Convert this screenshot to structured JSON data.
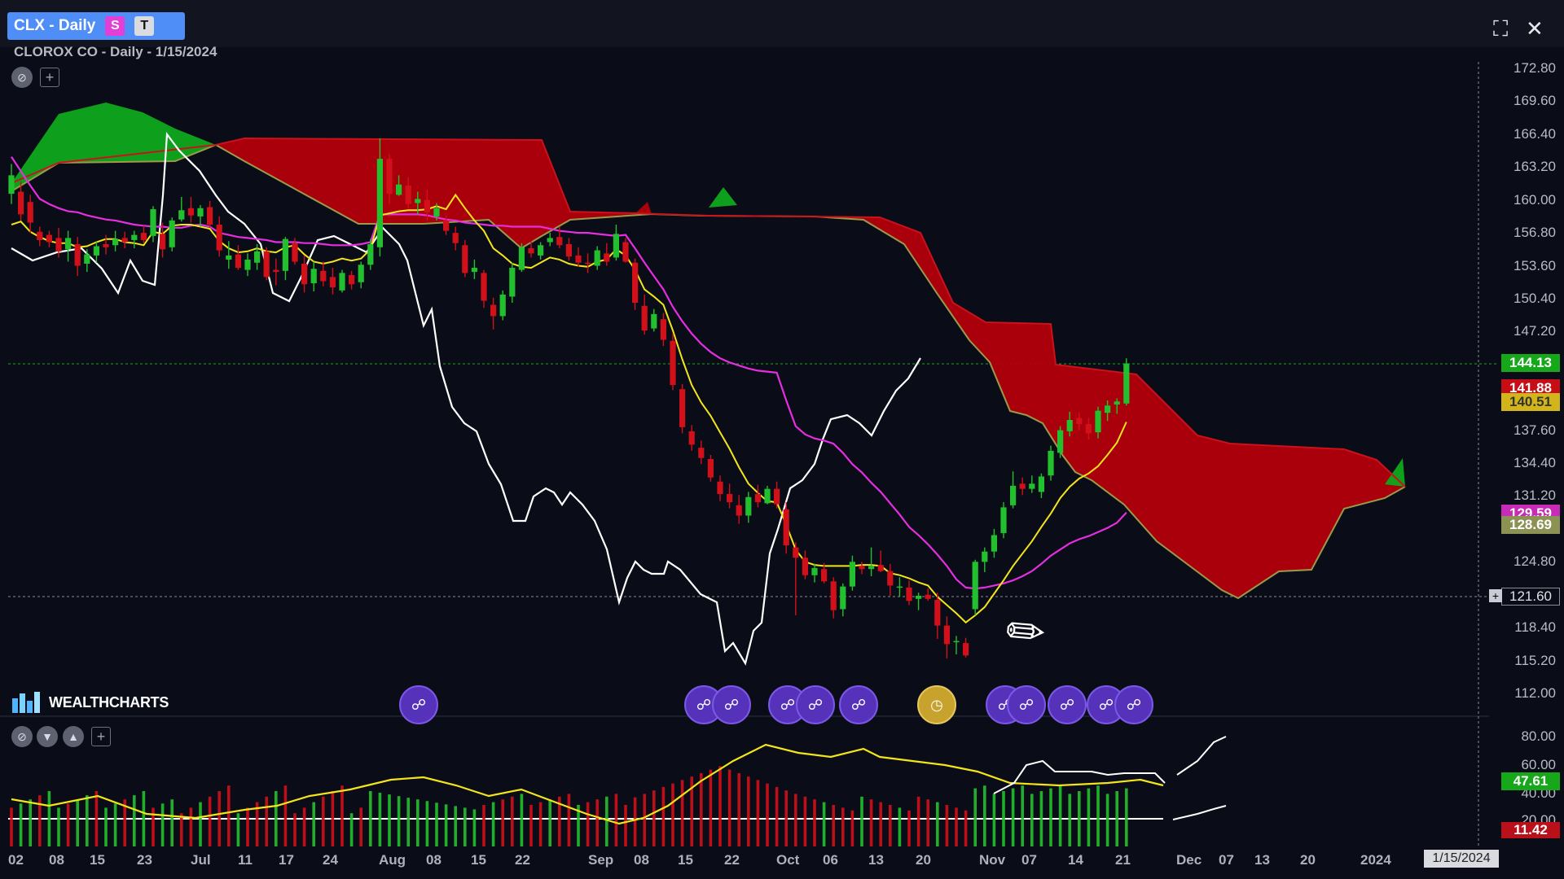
{
  "header": {
    "tab_title": "CLX - Daily",
    "badge_s": "S",
    "badge_t": "T",
    "subtitle": "CLOROX CO - Daily - 1/15/2024"
  },
  "toolbar_icons": [
    "no-entry-icon",
    "add-icon",
    "fullscreen-icon",
    "close-icon"
  ],
  "price_axis": [
    "172.80",
    "169.60",
    "166.40",
    "163.20",
    "160.00",
    "156.80",
    "153.60",
    "150.40",
    "147.20",
    "137.60",
    "134.40",
    "131.20",
    "128.00",
    "124.80",
    "118.40",
    "115.20",
    "112.00"
  ],
  "price_flags": {
    "last": "144.13",
    "red": "141.88",
    "yellow": "140.51",
    "magenta": "129.59",
    "olive": "128.69",
    "crosshair": "121.60"
  },
  "indicator_axis": [
    "80.00",
    "60.00",
    "40.00",
    "20.00"
  ],
  "indicator_flags": {
    "green": "47.61",
    "red": "11.42"
  },
  "date_axis": [
    "02",
    "08",
    "15",
    "23",
    "Jul",
    "11",
    "17",
    "24",
    "Aug",
    "08",
    "15",
    "22",
    "Sep",
    "08",
    "15",
    "22",
    "Oct",
    "06",
    "13",
    "20",
    "Nov",
    "07",
    "14",
    "21",
    "Dec",
    "07",
    "13",
    "20",
    "2024"
  ],
  "date_flag": "1/15/2024",
  "logo": {
    "text": "WEALTHCHARTS"
  },
  "colors": {
    "background": "#0a0d17",
    "bullish": "#22c02e",
    "bearish": "#d2101a",
    "cloud_bull": "#0fa81c",
    "cloud_bear": "#b3000c",
    "tenkan": "#f3e51c",
    "kijun": "#e52ee0",
    "chikou": "#ffffff",
    "span_line": "#9a9a4a",
    "accent": "#4f8ef7"
  },
  "chart_data": {
    "type": "candlestick",
    "ylim": [
      112.0,
      172.8
    ],
    "series": [
      {
        "values": [
          [
            160.6,
            163.5,
            159.6,
            162.4
          ],
          [
            160.8,
            161.8,
            158.0,
            158.6
          ],
          [
            159.8,
            160.5,
            156.8,
            157.8
          ],
          [
            156.9,
            157.4,
            155.5,
            156.1
          ],
          [
            156.6,
            157.0,
            155.4,
            155.9
          ],
          [
            156.3,
            157.3,
            154.4,
            155.0
          ],
          [
            155.2,
            157.0,
            154.0,
            156.3
          ],
          [
            155.7,
            156.4,
            152.6,
            153.6
          ],
          [
            153.8,
            155.2,
            153.0,
            154.7
          ],
          [
            154.6,
            156.0,
            153.9,
            155.5
          ],
          [
            155.7,
            156.6,
            154.7,
            155.4
          ],
          [
            155.6,
            157.0,
            155.0,
            156.2
          ],
          [
            156.3,
            156.9,
            155.3,
            155.9
          ],
          [
            156.1,
            157.0,
            155.3,
            156.6
          ],
          [
            156.8,
            157.5,
            155.8,
            156.1
          ],
          [
            156.5,
            159.4,
            155.9,
            159.1
          ],
          [
            156.7,
            157.8,
            154.4,
            155.2
          ],
          [
            155.4,
            158.3,
            155.0,
            158.0
          ],
          [
            158.1,
            160.3,
            157.9,
            159.0
          ],
          [
            159.2,
            160.3,
            157.8,
            158.5
          ],
          [
            158.4,
            159.5,
            157.4,
            159.2
          ],
          [
            159.3,
            159.9,
            157.3,
            157.6
          ],
          [
            157.6,
            158.4,
            154.5,
            155.1
          ],
          [
            154.2,
            156.0,
            153.3,
            154.6
          ],
          [
            154.7,
            155.6,
            153.2,
            153.4
          ],
          [
            153.2,
            154.8,
            152.6,
            154.2
          ],
          [
            153.9,
            155.7,
            153.2,
            155.0
          ],
          [
            155.0,
            155.4,
            152.2,
            152.5
          ],
          [
            153.2,
            154.3,
            151.7,
            153.0
          ],
          [
            153.1,
            156.4,
            152.2,
            156.2
          ],
          [
            155.8,
            156.3,
            153.7,
            154.0
          ],
          [
            153.8,
            154.6,
            151.0,
            151.8
          ],
          [
            151.9,
            154.0,
            151.1,
            153.3
          ],
          [
            153.1,
            154.0,
            151.6,
            152.1
          ],
          [
            152.5,
            153.4,
            150.8,
            151.5
          ],
          [
            151.2,
            153.2,
            151.0,
            152.9
          ],
          [
            152.7,
            153.1,
            151.3,
            151.8
          ],
          [
            152.0,
            154.0,
            151.4,
            153.7
          ],
          [
            153.7,
            156.2,
            153.2,
            155.7
          ],
          [
            155.4,
            166.0,
            154.5,
            164.0
          ],
          [
            164.0,
            164.5,
            159.6,
            160.6
          ],
          [
            160.5,
            162.4,
            160.4,
            161.5
          ],
          [
            161.4,
            162.2,
            159.2,
            159.6
          ],
          [
            159.7,
            160.8,
            158.6,
            160.1
          ],
          [
            160.0,
            161.0,
            158.0,
            158.8
          ],
          [
            158.4,
            159.7,
            158.0,
            159.2
          ],
          [
            158.0,
            158.5,
            156.6,
            157.0
          ],
          [
            156.8,
            157.4,
            155.1,
            155.8
          ],
          [
            155.6,
            156.1,
            152.5,
            152.9
          ],
          [
            153.0,
            154.2,
            152.3,
            153.4
          ],
          [
            152.9,
            153.2,
            149.5,
            150.2
          ],
          [
            149.8,
            150.5,
            147.4,
            148.7
          ],
          [
            148.7,
            151.2,
            148.3,
            150.8
          ],
          [
            150.6,
            153.9,
            150.0,
            153.4
          ],
          [
            153.2,
            155.8,
            153.0,
            155.4
          ],
          [
            155.3,
            156.0,
            154.4,
            154.8
          ],
          [
            154.6,
            155.9,
            154.2,
            155.6
          ],
          [
            155.9,
            156.8,
            155.5,
            156.3
          ],
          [
            156.4,
            157.4,
            155.3,
            155.6
          ],
          [
            155.7,
            156.3,
            154.1,
            154.5
          ],
          [
            154.6,
            155.4,
            153.5,
            153.9
          ],
          [
            153.9,
            154.8,
            152.9,
            153.8
          ],
          [
            153.6,
            155.5,
            153.2,
            155.1
          ],
          [
            154.8,
            155.8,
            153.6,
            154.0
          ],
          [
            154.4,
            157.6,
            154.1,
            156.7
          ],
          [
            155.9,
            156.3,
            153.9,
            154.0
          ],
          [
            153.9,
            154.3,
            149.3,
            150.0
          ],
          [
            149.7,
            150.8,
            146.9,
            147.3
          ],
          [
            147.5,
            149.4,
            147.2,
            148.9
          ],
          [
            148.4,
            149.0,
            145.8,
            146.4
          ],
          [
            146.3,
            147.0,
            141.5,
            142.0
          ],
          [
            141.6,
            142.1,
            137.3,
            137.9
          ],
          [
            137.5,
            138.1,
            135.6,
            136.2
          ],
          [
            135.9,
            136.6,
            134.3,
            134.9
          ],
          [
            134.8,
            135.2,
            132.6,
            133.0
          ],
          [
            132.6,
            133.2,
            130.7,
            131.4
          ],
          [
            131.4,
            132.4,
            130.0,
            130.6
          ],
          [
            130.3,
            131.3,
            128.5,
            129.3
          ],
          [
            129.3,
            131.6,
            128.6,
            131.1
          ],
          [
            131.4,
            132.3,
            130.1,
            130.6
          ],
          [
            130.5,
            132.2,
            130.4,
            131.9
          ],
          [
            131.9,
            132.6,
            130.0,
            130.4
          ],
          [
            129.9,
            130.6,
            125.6,
            126.4
          ],
          [
            126.2,
            126.7,
            119.6,
            125.2
          ],
          [
            125.2,
            125.9,
            123.1,
            123.5
          ],
          [
            123.5,
            124.6,
            122.8,
            124.2
          ],
          [
            124.1,
            124.7,
            122.7,
            122.9
          ],
          [
            122.9,
            123.3,
            119.3,
            120.1
          ],
          [
            120.2,
            122.7,
            119.5,
            122.4
          ],
          [
            122.4,
            125.4,
            122.0,
            124.8
          ],
          [
            124.4,
            124.8,
            123.6,
            124.1
          ],
          [
            124.1,
            126.2,
            123.4,
            124.4
          ],
          [
            124.5,
            125.9,
            123.8,
            123.9
          ],
          [
            123.9,
            124.6,
            121.5,
            122.5
          ],
          [
            122.4,
            123.3,
            121.4,
            122.4
          ],
          [
            122.3,
            123.0,
            120.6,
            121.0
          ],
          [
            121.2,
            121.8,
            120.1,
            121.5
          ],
          [
            121.6,
            122.2,
            121.0,
            121.2
          ],
          [
            121.1,
            121.8,
            117.3,
            118.6
          ],
          [
            118.6,
            119.5,
            115.4,
            116.8
          ],
          [
            117.0,
            117.6,
            115.8,
            117.1
          ],
          [
            116.9,
            117.4,
            115.5,
            115.7
          ],
          [
            120.2,
            125.0,
            119.6,
            124.8
          ],
          [
            124.8,
            126.2,
            123.8,
            125.8
          ],
          [
            125.8,
            128.0,
            125.2,
            127.4
          ],
          [
            127.6,
            130.6,
            127.1,
            130.1
          ],
          [
            130.3,
            133.6,
            130.0,
            132.2
          ],
          [
            132.4,
            133.0,
            131.3,
            131.9
          ],
          [
            131.9,
            133.2,
            131.5,
            132.4
          ],
          [
            131.6,
            133.4,
            131.0,
            133.1
          ],
          [
            133.2,
            136.1,
            132.7,
            135.6
          ],
          [
            135.4,
            138.0,
            134.9,
            137.6
          ],
          [
            137.5,
            139.4,
            137.0,
            138.6
          ],
          [
            138.8,
            139.3,
            137.6,
            138.2
          ],
          [
            138.2,
            138.8,
            136.7,
            137.3
          ],
          [
            137.4,
            139.9,
            136.8,
            139.5
          ],
          [
            139.3,
            140.5,
            138.5,
            140.0
          ],
          [
            140.1,
            140.7,
            139.2,
            140.4
          ],
          [
            140.2,
            144.6,
            140.0,
            144.1
          ]
        ]
      },
      {
        "name": "tenkan",
        "values": [
          157.6,
          157.9,
          156.9,
          156.4,
          156.0,
          155.8,
          155.8,
          155.4,
          155.5,
          155.9,
          156.2,
          156.2,
          155.9,
          155.8,
          155.6,
          156.9,
          156.7,
          157.5,
          157.6,
          157.6,
          157.4,
          157.2,
          156.0,
          155.3,
          154.9,
          155.0,
          155.3,
          155.0,
          154.9,
          155.4,
          155.6,
          154.7,
          154.0,
          153.8,
          154.0,
          154.3,
          154.1,
          154.3,
          155.2,
          158.5,
          158.7,
          158.9,
          159.0,
          159.0,
          159.1,
          159.4,
          159.1,
          160.5,
          159.2,
          158.0,
          157.0,
          155.3,
          154.6,
          153.8,
          153.5,
          153.4,
          153.9,
          154.4,
          154.2,
          153.8,
          153.6,
          153.5,
          154.0,
          154.2,
          155.2,
          154.6,
          153.2,
          151.3,
          150.6,
          149.8,
          147.3,
          144.5,
          142.0,
          140.3,
          139.0,
          137.4,
          135.8,
          134.0,
          132.4,
          131.5,
          130.7,
          130.6,
          128.4,
          126.0,
          124.8,
          124.5,
          124.4,
          124.4,
          124.4,
          124.4,
          124.5,
          124.5,
          124.4,
          123.7,
          123.5,
          123.2,
          122.8,
          122.5,
          121.4,
          120.6,
          119.8,
          118.9,
          119.6,
          120.4,
          121.7,
          123.0,
          124.4,
          125.6,
          126.8,
          128.2,
          129.5,
          131.0,
          132.1,
          132.9,
          133.4,
          134.1,
          135.2,
          136.4,
          138.4
        ]
      },
      {
        "name": "kijun",
        "values": [
          164.2,
          162.8,
          161.4,
          160.1,
          159.6,
          159.2,
          158.9,
          158.8,
          158.5,
          158.3,
          158.1,
          158.0,
          157.8,
          157.6,
          157.5,
          157.4,
          157.4,
          157.3,
          157.3,
          157.5,
          157.6,
          157.4,
          156.8,
          156.6,
          156.4,
          156.3,
          156.2,
          156.1,
          155.9,
          155.9,
          155.9,
          155.8,
          155.8,
          155.7,
          155.6,
          155.6,
          155.6,
          155.7,
          155.9,
          158.6,
          158.6,
          158.6,
          158.6,
          158.6,
          158.5,
          158.3,
          158.1,
          158.0,
          157.8,
          157.7,
          157.6,
          157.5,
          157.5,
          157.4,
          157.4,
          157.4,
          157.4,
          157.2,
          157.0,
          156.9,
          156.8,
          156.8,
          156.7,
          156.6,
          156.5,
          156.6,
          155.3,
          153.9,
          152.6,
          151.3,
          149.6,
          148.2,
          147.0,
          146.0,
          145.2,
          144.6,
          144.2,
          143.9,
          143.6,
          143.4,
          143.3,
          143.2,
          140.5,
          138.0,
          137.2,
          136.8,
          136.6,
          136.3,
          135.4,
          134.3,
          133.5,
          132.5,
          131.6,
          130.5,
          129.4,
          128.2,
          127.4,
          126.5,
          125.5,
          124.4,
          123.1,
          122.3,
          122.2,
          122.3,
          122.5,
          122.7,
          123.0,
          123.4,
          123.9,
          124.6,
          125.4,
          126.0,
          126.6,
          127.0,
          127.3,
          127.7,
          128.1,
          128.6,
          129.6
        ]
      }
    ]
  }
}
